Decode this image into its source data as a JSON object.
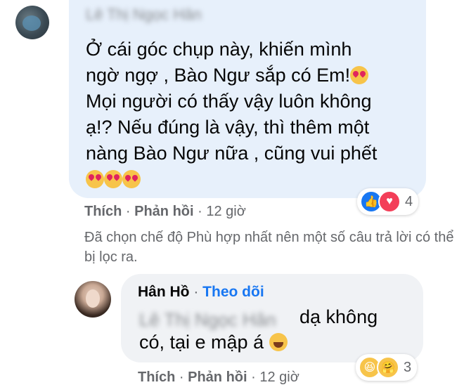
{
  "comment": {
    "author_blurred": "Lê Thị Ngọc Hân",
    "text": "Ở cái góc chụp này, khiến mình ngờ ngợ , Bào Ngư sắp có Em!🥰 Mọi người có thấy vậy luôn không ạ!? Nếu đúng là vậy, thì thêm một nàng Bào Ngư nữa , cũng vui phết 😍😍🥰",
    "lines": [
      "Ở cái góc chụp này, khiến mình",
      "ngờ ngợ , Bào Ngư sắp có Em!",
      "Mọi người có thấy vậy luôn không",
      "ạ!? Nếu đúng là vậy, thì thêm một",
      "nàng Bào Ngư nữa , cũng vui phết"
    ],
    "like_label": "Thích",
    "reply_label": "Phản hồi",
    "time": "12 giờ",
    "reaction_count": "4"
  },
  "notice": "Đã chọn chế độ Phù hợp nhất nên một số câu trả lời có thể bị lọc ra.",
  "reply": {
    "author": "Hân Hồ",
    "follow_label": "Theo dõi",
    "mention_blurred": "Lê Thị Ngọc Hân",
    "text_part1": "dạ không",
    "text_part2": "có, tại e mập á",
    "like_label": "Thích",
    "reply_label": "Phản hồi",
    "time": "12 giờ",
    "reaction_count": "3"
  },
  "icons": {
    "love_face": "smiling-face-with-hearts-icon",
    "heart_eyes": "heart-eyes-icon",
    "laughing": "rolling-laughing-icon",
    "like": "like-icon",
    "love": "love-icon",
    "haha": "haha-icon",
    "care": "care-icon"
  },
  "colors": {
    "link": "#1877f2",
    "meta": "#65676b",
    "bubble_highlight": "#e7f0fb",
    "bubble": "#f0f2f5"
  }
}
